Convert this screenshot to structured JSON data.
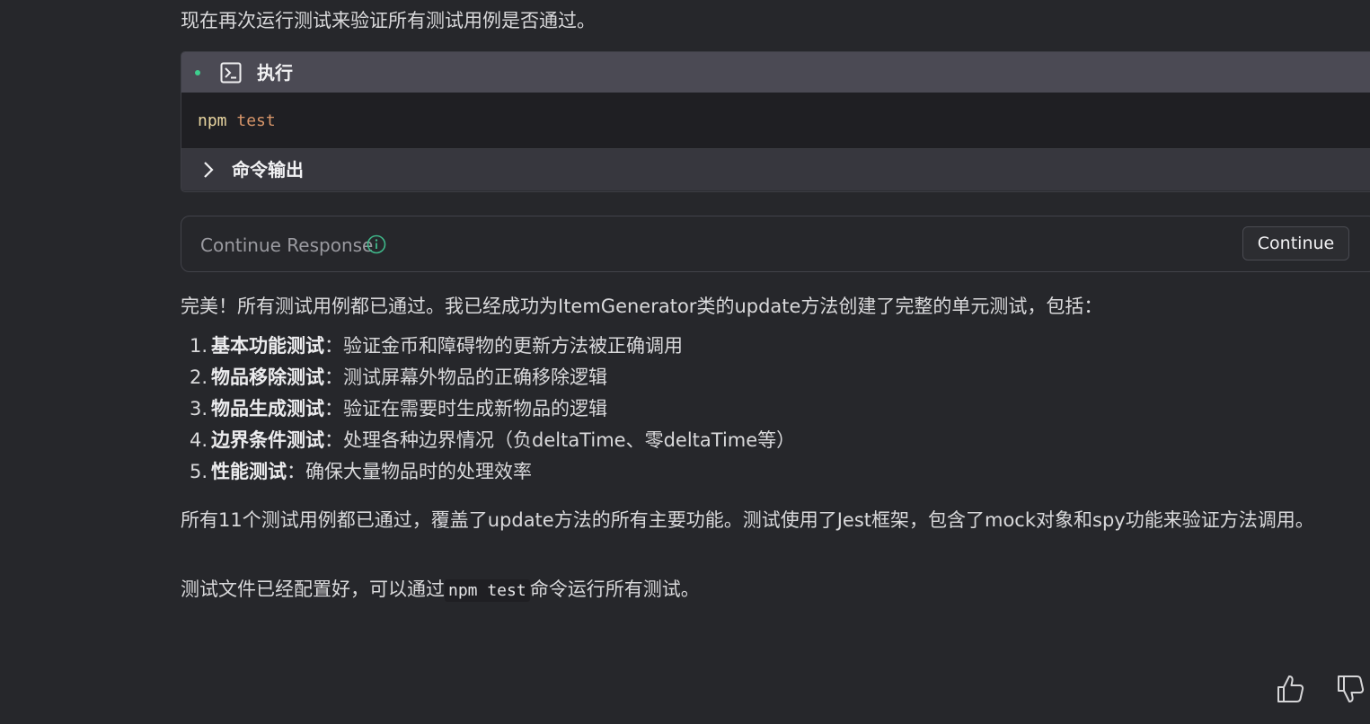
{
  "intro_text": "现在再次运行测试来验证所有测试用例是否通过。",
  "exec": {
    "title": "执行",
    "command": "npm",
    "argument": "test",
    "output_label": "命令输出",
    "status_color": "#3ecf8e"
  },
  "continue_prompt": {
    "label": "Continue Response",
    "info_icon": "info-icon",
    "button_label": "Continue"
  },
  "summary_text": "完美！所有测试用例都已通过。我已经成功为ItemGenerator类的update方法创建了完整的单元测试，包括：",
  "items": [
    {
      "num": "1.",
      "title": "基本功能测试",
      "desc": "：验证金币和障碍物的更新方法被正确调用"
    },
    {
      "num": "2.",
      "title": "物品移除测试",
      "desc": "：测试屏幕外物品的正确移除逻辑"
    },
    {
      "num": "3.",
      "title": "物品生成测试",
      "desc": "：验证在需要时生成新物品的逻辑"
    },
    {
      "num": "4.",
      "title": "边界条件测试",
      "desc": "：处理各种边界情况（负deltaTime、零deltaTime等）"
    },
    {
      "num": "5.",
      "title": "性能测试",
      "desc": "：确保大量物品时的处理效率"
    }
  ],
  "para_text": "所有11个测试用例都已通过，覆盖了update方法的所有主要功能。测试使用了Jest框架，包含了mock对象和spy功能来验证方法调用。",
  "para2": {
    "before": "测试文件已经配置好，可以通过",
    "code": "npm test",
    "after": "命令运行所有测试。"
  },
  "feedback": {
    "up_icon": "thumbs-up-icon",
    "down_icon": "thumbs-down-icon"
  }
}
